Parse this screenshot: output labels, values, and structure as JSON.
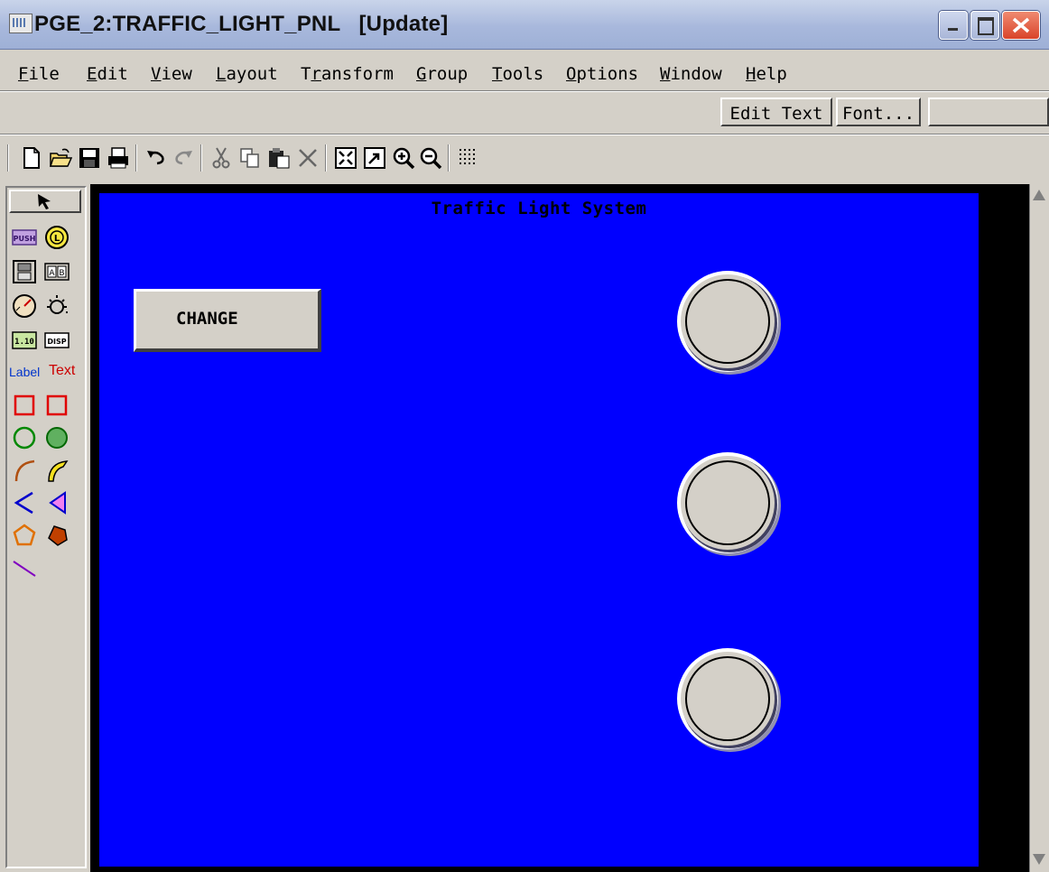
{
  "window": {
    "title": "PGE_2:TRAFFIC_LIGHT_PNL   [Update]"
  },
  "menu": [
    {
      "underline": "F",
      "rest": "ile"
    },
    {
      "underline": "E",
      "rest": "dit"
    },
    {
      "underline": "V",
      "rest": "iew"
    },
    {
      "underline": "L",
      "rest": "ayout"
    },
    {
      "pre": "T",
      "underline": "r",
      "rest": "ansform"
    },
    {
      "underline": "G",
      "rest": "roup"
    },
    {
      "underline": "T",
      "rest": "ools"
    },
    {
      "underline": "O",
      "rest": "ptions"
    },
    {
      "underline": "W",
      "rest": "indow"
    },
    {
      "underline": "H",
      "rest": "elp"
    }
  ],
  "text_tools": {
    "edit_text": "Edit Text",
    "font": "Font..."
  },
  "palette": {
    "label_tool": "Label",
    "text_tool": "Text"
  },
  "panel": {
    "title": "Traffic Light System",
    "change_button": "CHANGE",
    "canvas_color": "#0000ff",
    "lamp_color": "#d4d0c8"
  }
}
